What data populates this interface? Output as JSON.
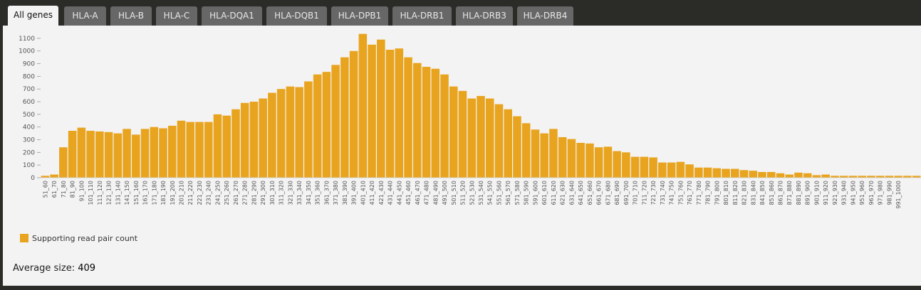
{
  "tabs": [
    {
      "label": "All genes",
      "active": true
    },
    {
      "label": "HLA-A"
    },
    {
      "label": "HLA-B"
    },
    {
      "label": "HLA-C"
    },
    {
      "label": "HLA-DQA1"
    },
    {
      "label": "HLA-DQB1"
    },
    {
      "label": "HLA-DPB1"
    },
    {
      "label": "HLA-DRB1"
    },
    {
      "label": "HLA-DRB3"
    },
    {
      "label": "HLA-DRB4"
    }
  ],
  "legend_label": "Supporting read pair count",
  "average": {
    "label": "Average size:",
    "value": "409"
  },
  "colors": {
    "bar": "#e8a41f",
    "background": "#f3f3f3",
    "tab_active": "#f3f3f3",
    "tab_inactive": "#676767"
  },
  "chart_data": {
    "type": "bar",
    "categories": [
      "51_60",
      "61_70",
      "71_80",
      "81_90",
      "91_100",
      "101_110",
      "111_120",
      "121_130",
      "131_140",
      "141_150",
      "151_160",
      "161_170",
      "171_180",
      "181_190",
      "191_200",
      "201_210",
      "211_220",
      "221_230",
      "231_240",
      "241_250",
      "251_260",
      "261_270",
      "271_280",
      "281_290",
      "291_300",
      "301_310",
      "311_320",
      "321_330",
      "331_340",
      "341_350",
      "351_360",
      "361_370",
      "371_380",
      "381_390",
      "391_400",
      "401_410",
      "411_420",
      "421_430",
      "431_440",
      "441_450",
      "451_460",
      "461_470",
      "471_480",
      "481_490",
      "491_500",
      "501_510",
      "511_520",
      "521_530",
      "531_540",
      "541_550",
      "551_560",
      "561_570",
      "571_580",
      "581_590",
      "591_600",
      "601_610",
      "611_620",
      "621_630",
      "631_640",
      "641_650",
      "651_660",
      "661_670",
      "671_680",
      "681_690",
      "691_700",
      "701_710",
      "711_720",
      "721_730",
      "731_740",
      "741_750",
      "751_760",
      "761_770",
      "771_780",
      "781_790",
      "791_800",
      "801_810",
      "811_820",
      "821_830",
      "831_840",
      "841_850",
      "851_860",
      "861_870",
      "871_880",
      "881_890",
      "891_900",
      "901_910",
      "911_920",
      "921_930",
      "931_940",
      "941_950",
      "951_960",
      "961_970",
      "971_980",
      "981_990",
      "991_1000"
    ],
    "series": [
      {
        "name": "Supporting read pair count",
        "values": [
          15,
          25,
          240,
          370,
          395,
          370,
          365,
          360,
          350,
          385,
          340,
          385,
          400,
          390,
          410,
          450,
          440,
          440,
          440,
          500,
          490,
          540,
          590,
          600,
          625,
          670,
          700,
          720,
          715,
          760,
          815,
          835,
          890,
          950,
          1000,
          1135,
          1050,
          1090,
          1010,
          1020,
          950,
          905,
          875,
          860,
          815,
          720,
          685,
          625,
          645,
          625,
          580,
          540,
          485,
          430,
          380,
          350,
          385,
          320,
          305,
          275,
          270,
          240,
          245,
          210,
          200,
          165,
          165,
          160,
          120,
          120,
          125,
          105,
          80,
          80,
          75,
          70,
          70,
          60,
          55,
          45,
          45,
          35,
          25,
          40,
          35,
          20,
          25,
          15,
          15,
          15,
          15,
          15,
          15,
          15,
          15,
          15,
          15
        ]
      }
    ],
    "yticks": [
      0,
      100,
      200,
      300,
      400,
      500,
      600,
      700,
      800,
      900,
      1000,
      1100
    ],
    "ylim": [
      0,
      1150
    ],
    "title": "",
    "xlabel": "",
    "ylabel": "",
    "legend_position": "bottom-left",
    "grid": false
  }
}
